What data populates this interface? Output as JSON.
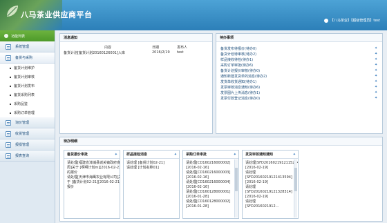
{
  "header": {
    "brand": "八马茶业供应商平台",
    "user_text": "【八马茶业】【超级管理员】test"
  },
  "sidebar": {
    "top_label": "功能列表",
    "items": [
      {
        "label": "系统管理"
      },
      {
        "label": "备货与采购",
        "active": true,
        "sub": [
          "备货计划维护",
          "备货计划审核",
          "备货计划发布",
          "备货采购列表",
          "采购品鉴",
          "采购订单管理"
        ]
      },
      {
        "label": "询价管理"
      },
      {
        "label": "收货管理"
      },
      {
        "label": "报损管理"
      },
      {
        "label": "报表查询"
      }
    ]
  },
  "messages": {
    "title": "消息通知",
    "headers": {
      "content": "内容",
      "date": "日期",
      "sender": "发布人"
    },
    "rows": [
      {
        "content": "备货计划[备货计划20160126001]入库",
        "date": "2016/2/19",
        "sender": "test"
      }
    ]
  },
  "todo": {
    "title": "待办事项",
    "items": [
      "备货发布待报价(待办0)",
      "备货计划待审核(待办2)",
      "样品接收待检(待办1)",
      "采购订单审批(待办6)",
      "备货计划报价审核(待办0)",
      "通知新建发货单的消息(待办2)",
      "发货单收货通知(待办1)",
      "发票审核消息通知(待办6)",
      "发票图片上传消息(待办1)",
      "发票付款登记消息(待办0)"
    ]
  },
  "pending": {
    "title": "待办明细",
    "cards": [
      {
        "title": "备货报价审批",
        "lines": [
          "请处理[福建省漳浦县城关镇政府食品",
          "周]关于 [啊啊计划m][2016-02-22]",
          "的报价",
          "请处理[天津市海鹰农业有限公司]关",
          "于 [备货计划02-21][2016-02-21]的",
          "报价"
        ]
      },
      {
        "title": "样品接检消息",
        "lines": [
          "请处理 [备货计划02-21]",
          "请处理 [计划名称01]"
        ]
      },
      {
        "title": "采购订单审批",
        "lines": [
          "请处理[CD160216000002]",
          "[2016-02-16]",
          "请处理[CD160216000003]",
          "[2016-02-16]",
          "请处理[CD160216000004]",
          "[2016-02-16]",
          "请处理[CD160128000001]",
          "[2016-01-28]",
          "请处理[CD160128000002]",
          "[2016-01-28]"
        ]
      },
      {
        "title": "发货审核通知通知",
        "lines": [
          "请处理[SFD20160219121152144]",
          "[2016-02-19]",
          "请处理",
          "[SFD20160219121413594]",
          "[2016-02-19]",
          "请处理",
          "[SFD20160219121328314]",
          "[2016-02-19]",
          "请处理",
          "[SFD2016021912..."
        ]
      }
    ]
  }
}
